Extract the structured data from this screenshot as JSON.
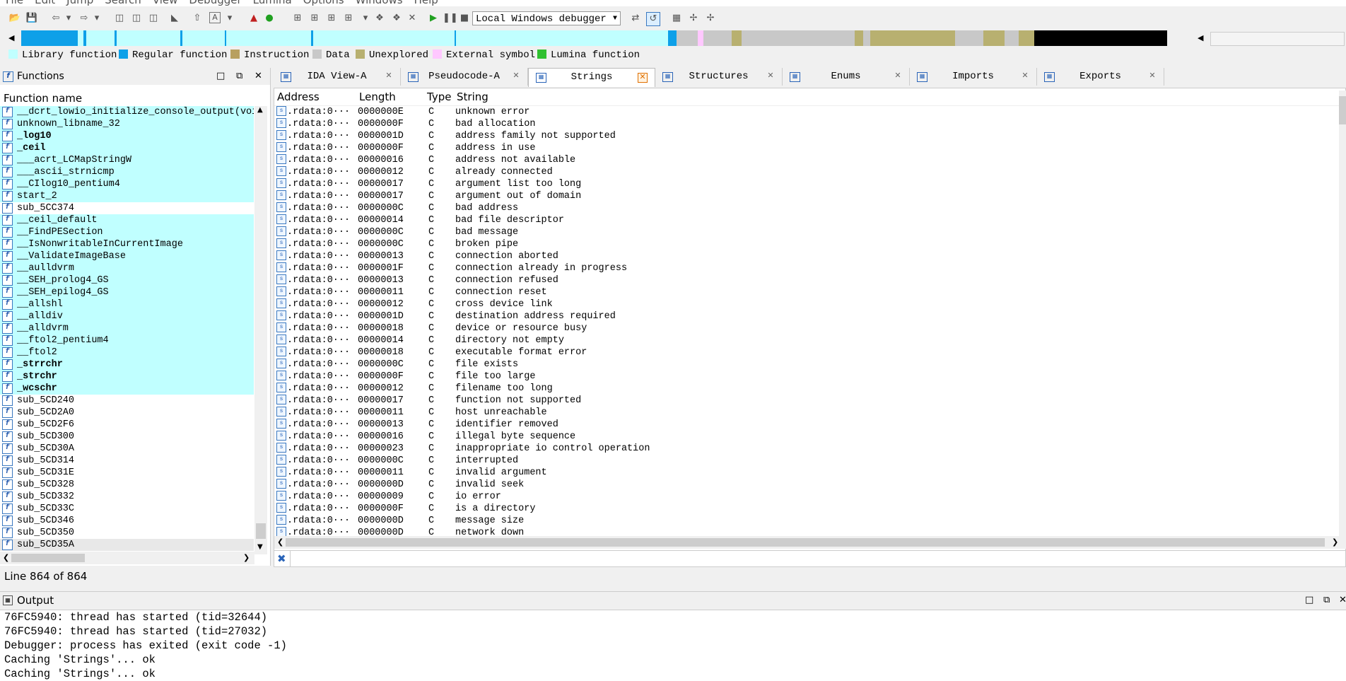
{
  "menu": [
    "File",
    "Edit",
    "Jump",
    "Search",
    "View",
    "Debugger",
    "Lumina",
    "Options",
    "Windows",
    "Help"
  ],
  "toolbar": {
    "debugger_select": "Local Windows debugger"
  },
  "colors": {
    "library": "#c0ffff",
    "regular": "#0ea0e8",
    "instruction": "#b8a060",
    "data": "#c8c8c8",
    "unexplored": "#b8b070",
    "external": "#ffc8ff",
    "lumina": "#30c030"
  },
  "legend": [
    {
      "label": "Library function",
      "color": "#c0ffff"
    },
    {
      "label": "Regular function",
      "color": "#0ea0e8"
    },
    {
      "label": "Instruction",
      "color": "#b8a060"
    },
    {
      "label": "Data",
      "color": "#c8c8c8"
    },
    {
      "label": "Unexplored",
      "color": "#b8b070"
    },
    {
      "label": "External symbol",
      "color": "#ffc8ff"
    },
    {
      "label": "Lumina function",
      "color": "#30c030"
    }
  ],
  "functions": {
    "title": "Functions",
    "column": "Function name",
    "status": "Line 864 of 864",
    "rows": [
      {
        "name": "__dcrt_lowio_initialize_console_output(voi",
        "lib": true,
        "bold": false
      },
      {
        "name": "unknown_libname_32",
        "lib": true,
        "bold": false
      },
      {
        "name": "_log10",
        "lib": true,
        "bold": true
      },
      {
        "name": "_ceil",
        "lib": true,
        "bold": true
      },
      {
        "name": "___acrt_LCMapStringW",
        "lib": true,
        "bold": false
      },
      {
        "name": "___ascii_strnicmp",
        "lib": true,
        "bold": false
      },
      {
        "name": "__CIlog10_pentium4",
        "lib": true,
        "bold": false
      },
      {
        "name": "start_2",
        "lib": true,
        "bold": false
      },
      {
        "name": "sub_5CC374",
        "lib": false,
        "bold": false
      },
      {
        "name": "__ceil_default",
        "lib": true,
        "bold": false
      },
      {
        "name": "__FindPESection",
        "lib": true,
        "bold": false
      },
      {
        "name": "__IsNonwritableInCurrentImage",
        "lib": true,
        "bold": false
      },
      {
        "name": "__ValidateImageBase",
        "lib": true,
        "bold": false
      },
      {
        "name": "__aulldvrm",
        "lib": true,
        "bold": false
      },
      {
        "name": "__SEH_prolog4_GS",
        "lib": true,
        "bold": false
      },
      {
        "name": "__SEH_epilog4_GS",
        "lib": true,
        "bold": false
      },
      {
        "name": "__allshl",
        "lib": true,
        "bold": false
      },
      {
        "name": "__alldiv",
        "lib": true,
        "bold": false
      },
      {
        "name": "__alldvrm",
        "lib": true,
        "bold": false
      },
      {
        "name": "__ftol2_pentium4",
        "lib": true,
        "bold": false
      },
      {
        "name": "__ftol2",
        "lib": true,
        "bold": false
      },
      {
        "name": "_strrchr",
        "lib": true,
        "bold": true
      },
      {
        "name": "_strchr",
        "lib": true,
        "bold": true
      },
      {
        "name": "_wcschr",
        "lib": true,
        "bold": true
      },
      {
        "name": "sub_5CD240",
        "lib": false,
        "bold": false
      },
      {
        "name": "sub_5CD2A0",
        "lib": false,
        "bold": false
      },
      {
        "name": "sub_5CD2F6",
        "lib": false,
        "bold": false
      },
      {
        "name": "sub_5CD300",
        "lib": false,
        "bold": false
      },
      {
        "name": "sub_5CD30A",
        "lib": false,
        "bold": false
      },
      {
        "name": "sub_5CD314",
        "lib": false,
        "bold": false
      },
      {
        "name": "sub_5CD31E",
        "lib": false,
        "bold": false
      },
      {
        "name": "sub_5CD328",
        "lib": false,
        "bold": false
      },
      {
        "name": "sub_5CD332",
        "lib": false,
        "bold": false
      },
      {
        "name": "sub_5CD33C",
        "lib": false,
        "bold": false
      },
      {
        "name": "sub_5CD346",
        "lib": false,
        "bold": false
      },
      {
        "name": "sub_5CD350",
        "lib": false,
        "bold": false
      },
      {
        "name": "sub_5CD35A",
        "lib": false,
        "bold": false,
        "selected": true
      }
    ]
  },
  "tabs": [
    {
      "label": "IDA View-A",
      "active": false
    },
    {
      "label": "Pseudocode-A",
      "active": false
    },
    {
      "label": "Strings",
      "active": true
    },
    {
      "label": "Structures",
      "active": false
    },
    {
      "label": "Enums",
      "active": false
    },
    {
      "label": "Imports",
      "active": false
    },
    {
      "label": "Exports",
      "active": false
    }
  ],
  "strings": {
    "headers": {
      "address": "Address",
      "length": "Length",
      "type": "Type",
      "string": "String"
    },
    "rows": [
      {
        "address": ".rdata:0···",
        "length": "0000000E",
        "type": "C",
        "string": "unknown error"
      },
      {
        "address": ".rdata:0···",
        "length": "0000000F",
        "type": "C",
        "string": "bad allocation"
      },
      {
        "address": ".rdata:0···",
        "length": "0000001D",
        "type": "C",
        "string": "address family not supported"
      },
      {
        "address": ".rdata:0···",
        "length": "0000000F",
        "type": "C",
        "string": "address in use"
      },
      {
        "address": ".rdata:0···",
        "length": "00000016",
        "type": "C",
        "string": "address not available"
      },
      {
        "address": ".rdata:0···",
        "length": "00000012",
        "type": "C",
        "string": "already connected"
      },
      {
        "address": ".rdata:0···",
        "length": "00000017",
        "type": "C",
        "string": "argument list too long"
      },
      {
        "address": ".rdata:0···",
        "length": "00000017",
        "type": "C",
        "string": "argument out of domain"
      },
      {
        "address": ".rdata:0···",
        "length": "0000000C",
        "type": "C",
        "string": "bad address"
      },
      {
        "address": ".rdata:0···",
        "length": "00000014",
        "type": "C",
        "string": "bad file descriptor"
      },
      {
        "address": ".rdata:0···",
        "length": "0000000C",
        "type": "C",
        "string": "bad message"
      },
      {
        "address": ".rdata:0···",
        "length": "0000000C",
        "type": "C",
        "string": "broken pipe"
      },
      {
        "address": ".rdata:0···",
        "length": "00000013",
        "type": "C",
        "string": "connection aborted"
      },
      {
        "address": ".rdata:0···",
        "length": "0000001F",
        "type": "C",
        "string": "connection already in progress"
      },
      {
        "address": ".rdata:0···",
        "length": "00000013",
        "type": "C",
        "string": "connection refused"
      },
      {
        "address": ".rdata:0···",
        "length": "00000011",
        "type": "C",
        "string": "connection reset"
      },
      {
        "address": ".rdata:0···",
        "length": "00000012",
        "type": "C",
        "string": "cross device link"
      },
      {
        "address": ".rdata:0···",
        "length": "0000001D",
        "type": "C",
        "string": "destination address required"
      },
      {
        "address": ".rdata:0···",
        "length": "00000018",
        "type": "C",
        "string": "device or resource busy"
      },
      {
        "address": ".rdata:0···",
        "length": "00000014",
        "type": "C",
        "string": "directory not empty"
      },
      {
        "address": ".rdata:0···",
        "length": "00000018",
        "type": "C",
        "string": "executable format error"
      },
      {
        "address": ".rdata:0···",
        "length": "0000000C",
        "type": "C",
        "string": "file exists"
      },
      {
        "address": ".rdata:0···",
        "length": "0000000F",
        "type": "C",
        "string": "file too large"
      },
      {
        "address": ".rdata:0···",
        "length": "00000012",
        "type": "C",
        "string": "filename too long"
      },
      {
        "address": ".rdata:0···",
        "length": "00000017",
        "type": "C",
        "string": "function not supported"
      },
      {
        "address": ".rdata:0···",
        "length": "00000011",
        "type": "C",
        "string": "host unreachable"
      },
      {
        "address": ".rdata:0···",
        "length": "00000013",
        "type": "C",
        "string": "identifier removed"
      },
      {
        "address": ".rdata:0···",
        "length": "00000016",
        "type": "C",
        "string": "illegal byte sequence"
      },
      {
        "address": ".rdata:0···",
        "length": "00000023",
        "type": "C",
        "string": "inappropriate io control operation"
      },
      {
        "address": ".rdata:0···",
        "length": "0000000C",
        "type": "C",
        "string": "interrupted"
      },
      {
        "address": ".rdata:0···",
        "length": "00000011",
        "type": "C",
        "string": "invalid argument"
      },
      {
        "address": ".rdata:0···",
        "length": "0000000D",
        "type": "C",
        "string": "invalid seek"
      },
      {
        "address": ".rdata:0···",
        "length": "00000009",
        "type": "C",
        "string": "io error"
      },
      {
        "address": ".rdata:0···",
        "length": "0000000F",
        "type": "C",
        "string": "is a directory"
      },
      {
        "address": ".rdata:0···",
        "length": "0000000D",
        "type": "C",
        "string": "message size"
      },
      {
        "address": ".rdata:0···",
        "length": "0000000D",
        "type": "C",
        "string": "network down"
      }
    ]
  },
  "output": {
    "title": "Output",
    "lines": [
      "76FC5940: thread has started (tid=32644)",
      "76FC5940: thread has started (tid=27032)",
      "Debugger: process has exited (exit code -1)",
      "Caching 'Strings'... ok",
      "Caching 'Strings'... ok"
    ]
  }
}
